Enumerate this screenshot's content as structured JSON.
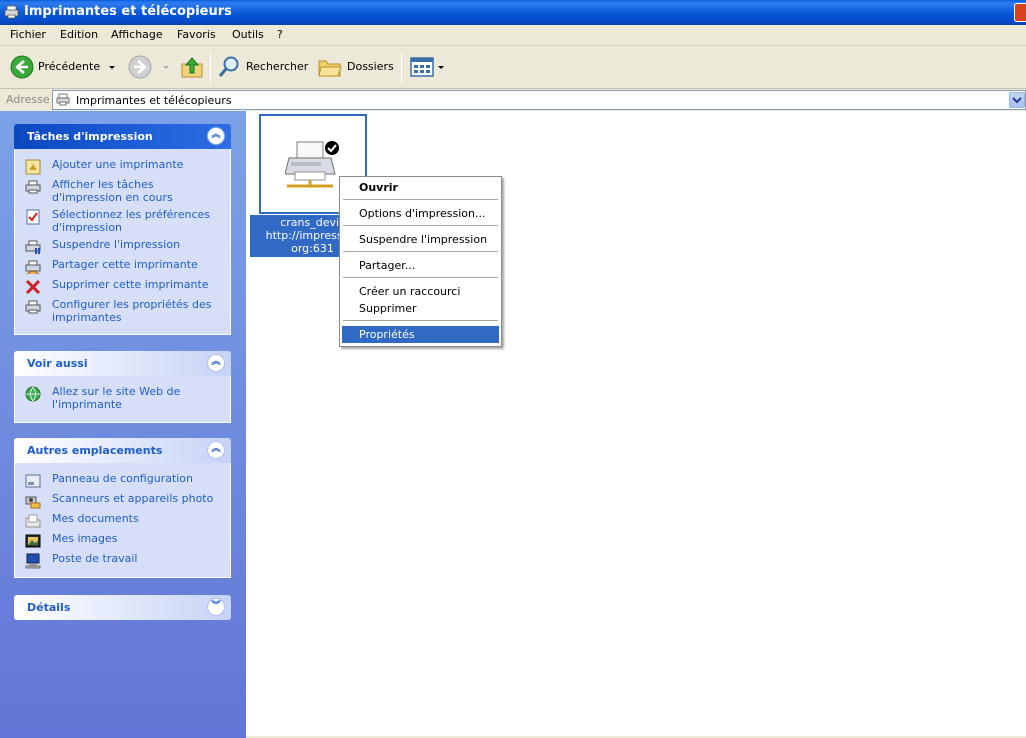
{
  "window": {
    "title": "Imprimantes et télécopieurs"
  },
  "menubar": {
    "items": [
      "Fichier",
      "Edition",
      "Affichage",
      "Favoris",
      "Outils",
      "?"
    ]
  },
  "toolbar": {
    "back_label": "Précédente",
    "search_label": "Rechercher",
    "folders_label": "Dossiers"
  },
  "address": {
    "label": "Adresse",
    "value": "Imprimantes et télécopieurs"
  },
  "panels": {
    "print_tasks": {
      "title": "Tâches d'impression",
      "items": [
        "Ajouter une imprimante",
        "Afficher les tâches d'impression en cours",
        "Sélectionnez les préférences d'impression",
        "Suspendre l'impression",
        "Partager cette imprimante",
        "Supprimer cette imprimante",
        "Configurer les propriétés des imprimantes"
      ]
    },
    "see_also": {
      "title": "Voir aussi",
      "items": [
        "Allez sur le site Web de l'imprimante"
      ]
    },
    "other_places": {
      "title": "Autres emplacements",
      "items": [
        "Panneau de configuration",
        "Scanneurs et appareils photo",
        "Mes documents",
        "Mes images",
        "Poste de travail"
      ]
    },
    "details": {
      "title": "Détails"
    }
  },
  "printer": {
    "name_line1": "crans_devis",
    "name_line2": "http://impression",
    "name_line3": "org:631"
  },
  "context_menu": {
    "items": [
      "Ouvrir",
      "Options d'impression...",
      "Suspendre l'impression",
      "Partager...",
      "Créer un raccourci",
      "Supprimer",
      "Propriétés"
    ],
    "selected": "Propriétés"
  },
  "colors": {
    "title_bar": "#0a5ad8",
    "selection": "#316ac5",
    "link": "#215dc6",
    "pane_bg": "#7ba2e7"
  }
}
